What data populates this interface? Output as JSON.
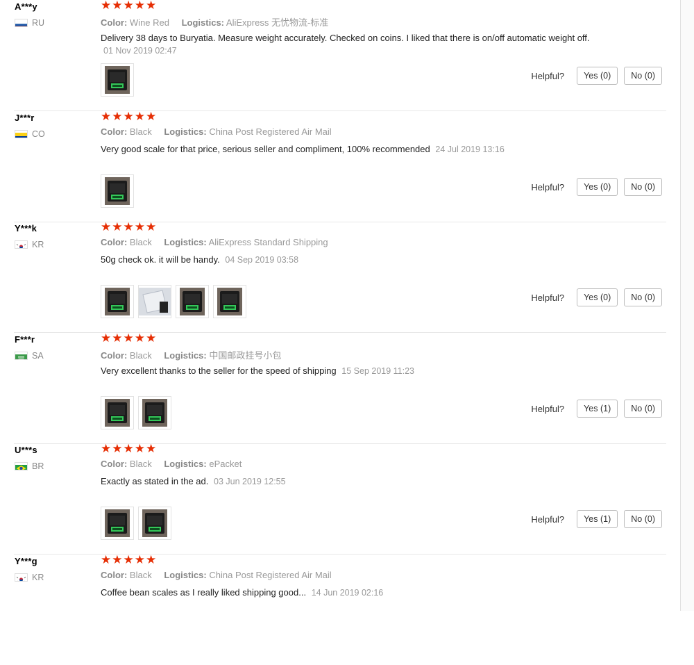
{
  "labels": {
    "color": "Color:",
    "logistics": "Logistics:",
    "helpful": "Helpful?"
  },
  "colors": {
    "star": "#e62e04",
    "separator": "#e8e8e8"
  },
  "reviews": [
    {
      "user": "A***y",
      "country": "RU",
      "flag": "flag-ru-icon",
      "stars": "★★★★★",
      "color": "Wine Red",
      "logistics": "AliExpress 无忧物流-标准",
      "comment": "Delivery 38 days to Buryatia. Measure weight accurately. Checked on coins. I liked that there is on/off automatic weight off.",
      "date": "01 Nov 2019 02:47",
      "photos": [
        "scale-photo-icon"
      ],
      "yes": "Yes (0)",
      "no": "No (0)"
    },
    {
      "user": "J***r",
      "country": "CO",
      "flag": "flag-co-icon",
      "stars": "★★★★★",
      "color": "Black",
      "logistics": "China Post Registered Air Mail",
      "comment": "Very good scale for that price, serious seller and compliment, 100% recommended",
      "date": "24 Jul 2019 13:16",
      "photos": [
        "scale-photo-icon"
      ],
      "yes": "Yes (0)",
      "no": "No (0)"
    },
    {
      "user": "Y***k",
      "country": "KR",
      "flag": "flag-kr-icon",
      "stars": "★★★★★",
      "color": "Black",
      "logistics": "AliExpress Standard Shipping",
      "comment": "50g check ok. it will be handy.",
      "date": "04 Sep 2019 03:58",
      "photos": [
        "scale-photo-icon",
        "package-photo-icon",
        "scale-photo-icon",
        "scale-photo-icon"
      ],
      "yes": "Yes (0)",
      "no": "No (0)"
    },
    {
      "user": "F***r",
      "country": "SA",
      "flag": "flag-sa-icon",
      "stars": "★★★★★",
      "color": "Black",
      "logistics": "中国邮政挂号小包",
      "comment": "Very excellent thanks to the seller for the speed of shipping",
      "date": "15 Sep 2019 11:23",
      "photos": [
        "scale-photo-icon",
        "scale-photo-icon"
      ],
      "yes": "Yes (1)",
      "no": "No (0)"
    },
    {
      "user": "U***s",
      "country": "BR",
      "flag": "flag-br-icon",
      "stars": "★★★★★",
      "color": "Black",
      "logistics": "ePacket",
      "comment": "Exactly as stated in the ad.",
      "date": "03 Jun 2019 12:55",
      "photos": [
        "scale-photo-icon",
        "scale-photo-icon"
      ],
      "yes": "Yes (1)",
      "no": "No (0)"
    },
    {
      "user": "Y***g",
      "country": "KR",
      "flag": "flag-kr-icon",
      "stars": "★★★★★",
      "color": "Black",
      "logistics": "China Post Registered Air Mail",
      "comment": "Coffee bean scales as I really liked shipping good...",
      "date": "14 Jun 2019 02:16",
      "photos": [],
      "yes": "",
      "no": ""
    }
  ]
}
